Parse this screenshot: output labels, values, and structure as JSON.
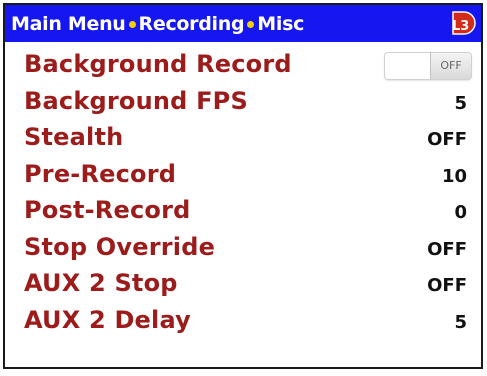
{
  "header": {
    "breadcrumbs": [
      "Main Menu",
      "Recording",
      "Misc"
    ],
    "logo_text": "L3"
  },
  "colors": {
    "header_bg": "#1616f0",
    "separator": "#f5d000",
    "label": "#9c1c1c",
    "value": "#111111",
    "logo": "#d42a1a"
  },
  "settings": [
    {
      "label": "Background Record",
      "value": "OFF",
      "control": "toggle"
    },
    {
      "label": "Background FPS",
      "value": "5"
    },
    {
      "label": "Stealth",
      "value": "OFF"
    },
    {
      "label": "Pre-Record",
      "value": "10"
    },
    {
      "label": "Post-Record",
      "value": "0"
    },
    {
      "label": "Stop Override",
      "value": "OFF"
    },
    {
      "label": "AUX 2 Stop",
      "value": "OFF"
    },
    {
      "label": "AUX 2 Delay",
      "value": "5"
    }
  ]
}
